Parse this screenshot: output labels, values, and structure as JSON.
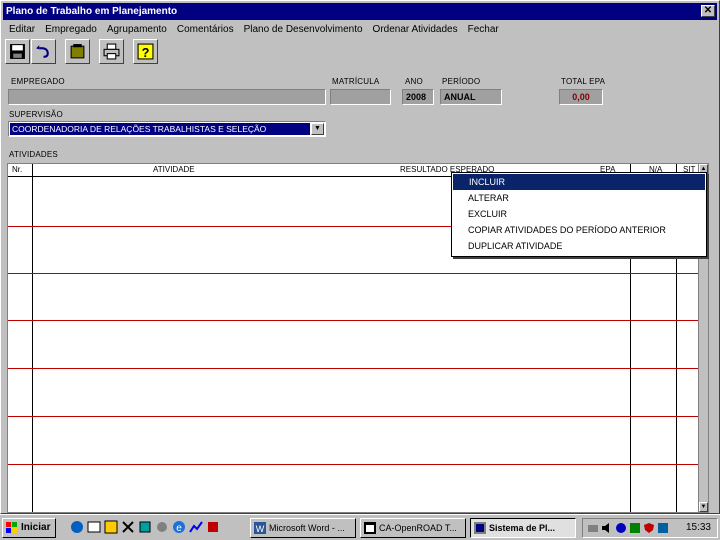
{
  "window": {
    "title": "Plano de Trabalho em Planejamento",
    "close_label": "✕"
  },
  "menu": [
    "Editar",
    "Empregado",
    "Agrupamento",
    "Comentários",
    "Plano de Desenvolvimento",
    "Ordenar Atividades",
    "Fechar"
  ],
  "toolbar": {
    "buttons": [
      "save-icon",
      "undo-icon",
      "card-icon",
      "print-icon",
      "help-icon"
    ]
  },
  "form": {
    "empregado_label": "EMPREGADO",
    "empregado_value": "",
    "matricula_label": "MATRÍCULA",
    "matricula_value": "",
    "ano_label": "ANO",
    "ano_value": "2008",
    "periodo_label": "PERÍODO",
    "periodo_value": "ANUAL",
    "total_epa_label": "TOTAL EPA",
    "total_epa_value": "0,00",
    "supervisao_label": "SUPERVISÃO",
    "supervisao_value": "COORDENADORIA DE RELAÇÕES TRABALHISTAS E SELEÇÃO",
    "atividades_label": "ATIVIDADES"
  },
  "grid": {
    "columns": [
      "Nr.",
      "ATIVIDADE",
      "RESULTADO ESPERADO",
      "EPA",
      "N/A",
      "SIT"
    ],
    "rows": 6
  },
  "context_menu": {
    "items": [
      "INCLUIR",
      "ALTERAR",
      "EXCLUIR",
      "COPIAR ATIVIDADES DO PERÍODO ANTERIOR",
      "DUPLICAR ATIVIDADE"
    ],
    "selected_index": 0
  },
  "taskbar": {
    "start_label": "Iniciar",
    "tasks": [
      "Microsoft Word - ...",
      "CA-OpenROAD T...",
      "Sistema de Pl..."
    ],
    "active_task_index": 2,
    "clock": "15:33"
  },
  "colors": {
    "title_bar": "#000080",
    "row_line": "#c00000",
    "selection": "#0a246a",
    "epa_text": "#800000"
  }
}
